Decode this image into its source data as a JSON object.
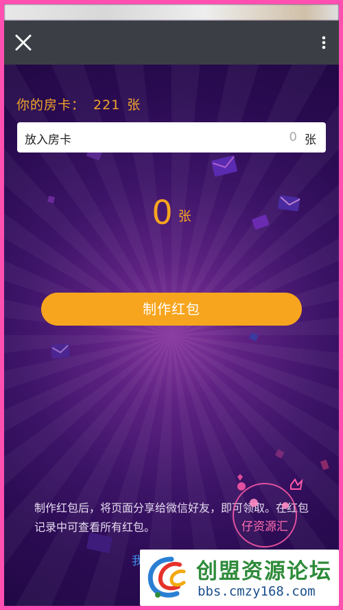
{
  "nav": {
    "close_icon": "close-icon",
    "more_icon": "more-vertical-icon"
  },
  "room_cards": {
    "label": "你的房卡：",
    "count": "221",
    "unit": "张"
  },
  "input": {
    "label": "放入房卡",
    "value": "0",
    "unit": "张"
  },
  "selected": {
    "count": "0",
    "unit": "张"
  },
  "make_button": {
    "label": "制作红包"
  },
  "hint": {
    "text": "制作红包后，将页面分享给微信好友，即可领取。在红包记录中可查看所有红包。"
  },
  "bottom_link": {
    "text": "我"
  },
  "watermark": {
    "stamp_text": "仔资源汇",
    "site_name": "创盟资源论坛",
    "site_url": "bbs.cmzy168.com"
  },
  "colors": {
    "accent": "#f7a51e",
    "link": "#3f8ee8",
    "nav_bg": "#3b3f45",
    "background": "#2a0b52"
  }
}
